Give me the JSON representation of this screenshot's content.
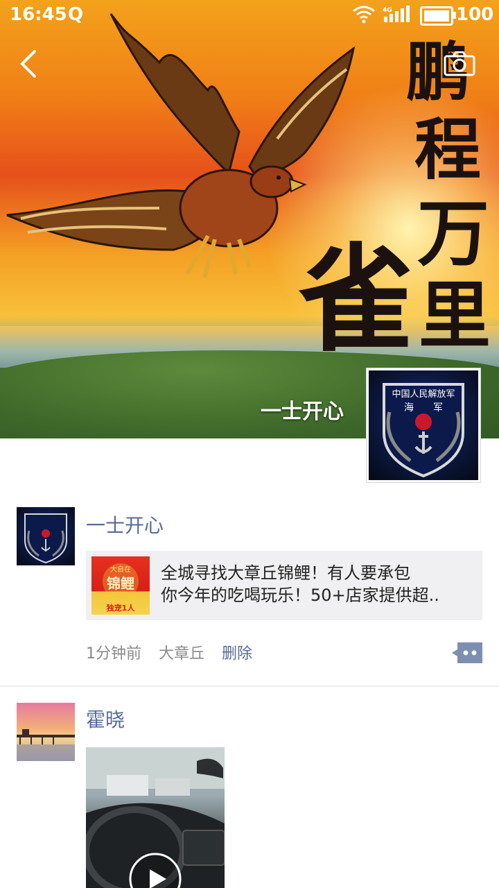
{
  "status_bar": {
    "time": "16:45",
    "q_icon": "Q",
    "network": "4G",
    "battery": "100"
  },
  "cover": {
    "calligraphy": [
      "鹏",
      "程",
      "万",
      "里",
      "雀"
    ],
    "name": "一士开心",
    "badge_text": [
      "中国人民解放军",
      "海",
      "军"
    ]
  },
  "posts": [
    {
      "author": "一士开心",
      "link_title_line1": "全城寻找大章丘锦鲤！有人要承包",
      "link_title_line2": "你今年的吃喝玩乐！50+店家提供超..",
      "thumb_text_top": "大自在",
      "thumb_text_mid": "锦鲤",
      "thumb_text_bottom": "独宠1人",
      "time": "1分钟前",
      "location": "大章丘",
      "delete": "删除"
    },
    {
      "author": "霍晓"
    }
  ],
  "colors": {
    "link_blue": "#576b95",
    "meta_gray": "#8a8a8a",
    "divider": "#ececec"
  },
  "icons": [
    "back-arrow-icon",
    "camera-icon",
    "comment-icon",
    "play-icon",
    "wifi-icon",
    "signal-icon",
    "battery-icon"
  ]
}
